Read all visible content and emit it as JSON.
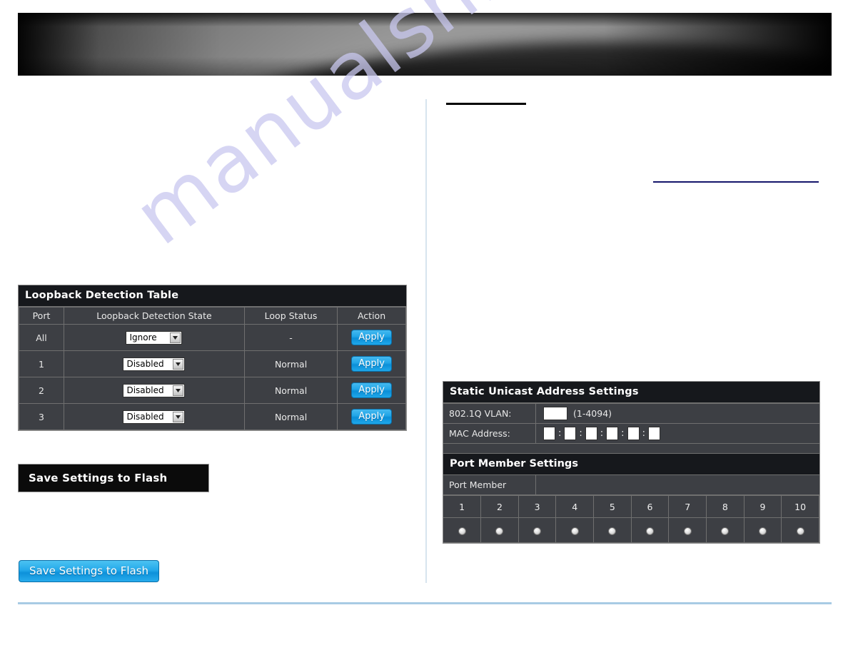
{
  "page": {
    "banner_alt": "product-banner",
    "watermark": "manualshive.com"
  },
  "loopback": {
    "title": "Loopback Detection Table",
    "columns": [
      "Port",
      "Loopback Detection State",
      "Loop Status",
      "Action"
    ],
    "action_label": "Apply",
    "rows": [
      {
        "port": "All",
        "state": "Ignore",
        "status": "-",
        "action": "Apply"
      },
      {
        "port": "1",
        "state": "Disabled",
        "status": "Normal",
        "action": "Apply"
      },
      {
        "port": "2",
        "state": "Disabled",
        "status": "Normal",
        "action": "Apply"
      },
      {
        "port": "3",
        "state": "Disabled",
        "status": "Normal",
        "action": "Apply"
      }
    ]
  },
  "save_flash_bar": {
    "label": "Save Settings to Flash"
  },
  "save_flash_button": {
    "label": "Save Settings to Flash"
  },
  "static_unicast": {
    "title": "Static Unicast Address Settings",
    "vlan_label": "802.1Q VLAN:",
    "vlan_value": "",
    "vlan_hint": "(1-4094)",
    "mac_label": "MAC Address:",
    "mac_octets": [
      "",
      "",
      "",
      "",
      "",
      ""
    ],
    "mac_separator": ":",
    "port_member_title": "Port Member Settings",
    "port_member_label": "Port Member",
    "ports": [
      "1",
      "2",
      "3",
      "4",
      "5",
      "6",
      "7",
      "8",
      "9",
      "10"
    ]
  },
  "colors": {
    "table_bar": "#16181c",
    "table_body": "#3d3f44",
    "table_border": "#6f6f6f",
    "accent_blue": "#22a6e8",
    "rule_navy": "#15166b",
    "rule_footer": "#a8cbe4",
    "divider": "#d7e4ee",
    "watermark": "#c9c8ef"
  }
}
